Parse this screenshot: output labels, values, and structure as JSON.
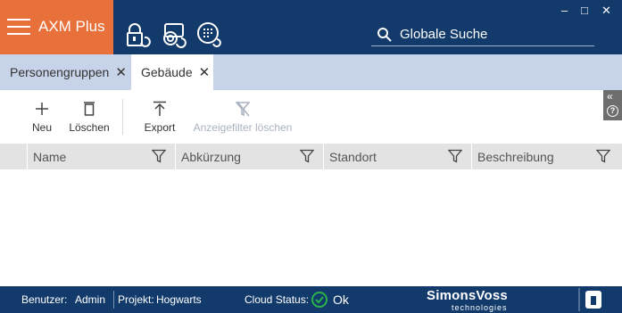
{
  "app": {
    "name": "AXM Plus",
    "accent": "#e8703a",
    "titlebar_color": "#123a6b"
  },
  "titlebar": {
    "icons": [
      "lock-sync-icon",
      "card-sync-icon",
      "keypad-sync-icon"
    ],
    "window_controls": {
      "minimize": "–",
      "maximize": "□",
      "close": "✕"
    }
  },
  "search": {
    "placeholder": "Globale Suche",
    "icon": "search-icon"
  },
  "tabs": [
    {
      "label": "Personengruppen",
      "active": false
    },
    {
      "label": "Gebäude",
      "active": true
    }
  ],
  "toolbar": {
    "new_label": "Neu",
    "delete_label": "Löschen",
    "export_label": "Export",
    "clear_filter_label": "Anzeigefilter löschen"
  },
  "side_panel": {
    "collapse": "«",
    "help": "?"
  },
  "table": {
    "columns": [
      "Name",
      "Abkürzung",
      "Standort",
      "Beschreibung"
    ],
    "rows": []
  },
  "statusbar": {
    "user_label": "Benutzer:",
    "user_value": "Admin",
    "project_label": "Projekt:",
    "project_value": "Hogwarts",
    "cloud_label": "Cloud Status:",
    "cloud_value": "Ok",
    "status_color": "#2bb24c"
  },
  "branding": {
    "logo_main": "SimonsVoss",
    "logo_sub": "technologies"
  }
}
